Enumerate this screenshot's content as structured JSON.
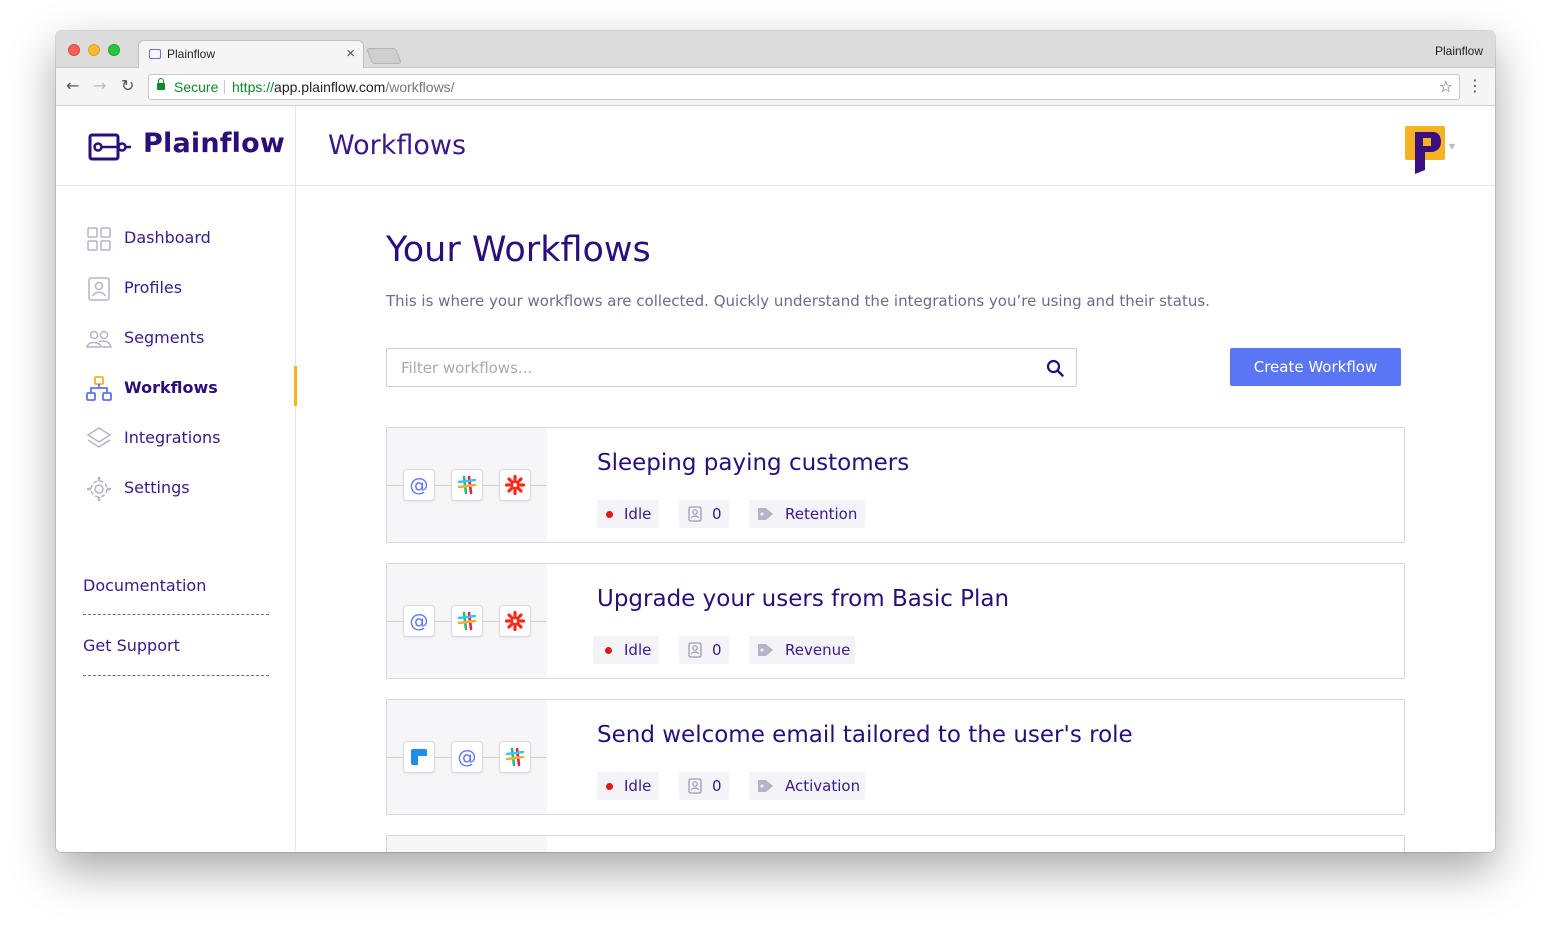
{
  "browser": {
    "tab_title": "Plainflow",
    "profile_name": "Plainflow",
    "secure_label": "Secure",
    "url_scheme": "https://",
    "url_host": "app.plainflow.com",
    "url_path": "/workflows/"
  },
  "brand": {
    "name": "Plainflow"
  },
  "header": {
    "title": "Workflows"
  },
  "sidebar": {
    "items": [
      {
        "label": "Dashboard",
        "icon": "dashboard-icon"
      },
      {
        "label": "Profiles",
        "icon": "profiles-icon"
      },
      {
        "label": "Segments",
        "icon": "segments-icon"
      },
      {
        "label": "Workflows",
        "icon": "workflows-icon",
        "active": true
      },
      {
        "label": "Integrations",
        "icon": "integrations-icon"
      },
      {
        "label": "Settings",
        "icon": "settings-icon"
      }
    ],
    "links": [
      "Documentation",
      "Get Support"
    ]
  },
  "main": {
    "heading": "Your Workflows",
    "subheading": "This is where your workflows are collected. Quickly understand the integrations you’re using and their status.",
    "filter_placeholder": "Filter workflows...",
    "create_label": "Create Workflow",
    "workflows": [
      {
        "title": "Sleeping paying customers",
        "status": "Idle",
        "profiles": "0",
        "tag": "Retention",
        "integrations": [
          "email-icon",
          "slack-icon",
          "zapier-icon"
        ]
      },
      {
        "title": "Upgrade your users from Basic Plan",
        "status": "Idle",
        "profiles": "0",
        "tag": "Revenue",
        "integrations": [
          "email-icon",
          "slack-icon",
          "zapier-icon"
        ]
      },
      {
        "title": "Send welcome email tailored to the user's role",
        "status": "Idle",
        "profiles": "0",
        "tag": "Activation",
        "integrations": [
          "intercom-icon",
          "email-icon",
          "slack-icon"
        ]
      }
    ]
  },
  "colors": {
    "brand": "#2a0f7a",
    "accent": "#5a76f3",
    "active_marker": "#f5b324",
    "status_idle": "#e01616"
  }
}
